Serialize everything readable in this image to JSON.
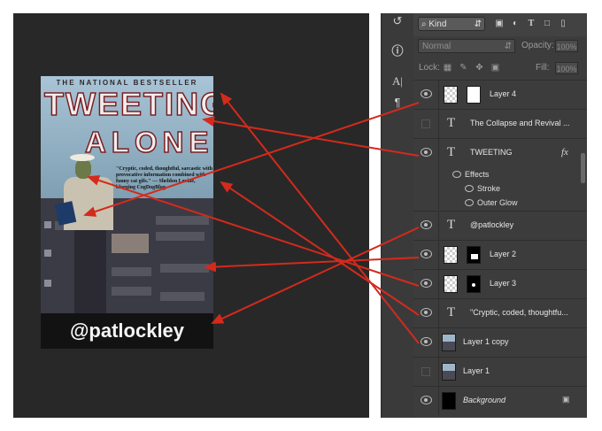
{
  "poster": {
    "subtitle": "THE NATIONAL BESTSELLER",
    "title_line1": "TWEETING",
    "title_line2": "ALONE",
    "quote": "\"Cryptic, coded, thoughtful, sarcastic with provocative information combined with funny cat gifs.\" — Sheldon Levine, blogging CogDogBlog",
    "handle": "@patlockley"
  },
  "panel": {
    "filter_kind": "Kind",
    "blend_mode": "Normal",
    "opacity_label": "Opacity:",
    "opacity_value": "100%",
    "lock_label": "Lock:",
    "fill_label": "Fill:",
    "fill_value": "100%",
    "layers": [
      {
        "name": "Layer 4",
        "type": "image",
        "visible": true
      },
      {
        "name": "The  Collapse and Revival ...",
        "type": "text",
        "visible": false
      },
      {
        "name": "TWEETING",
        "type": "text",
        "visible": true,
        "fx": "fx"
      },
      {
        "name": "@patlockley",
        "type": "text",
        "visible": true
      },
      {
        "name": "Layer 2",
        "type": "image",
        "visible": true
      },
      {
        "name": "Layer 3",
        "type": "image",
        "visible": true
      },
      {
        "name": "\"Cryptic, coded, thoughtfu...",
        "type": "text",
        "visible": true
      },
      {
        "name": "Layer 1 copy",
        "type": "image",
        "visible": true
      },
      {
        "name": "Layer 1",
        "type": "image",
        "visible": false
      },
      {
        "name": "Background",
        "type": "image",
        "visible": true,
        "locked": true
      }
    ],
    "effects": {
      "title": "Effects",
      "items": [
        "Stroke",
        "Outer Glow"
      ]
    }
  },
  "tools": [
    "history-icon",
    "info-icon",
    "character-icon",
    "paragraph-icon"
  ],
  "colors": {
    "arrow": "#d42a1c",
    "panel_bg": "#3c3c3c",
    "canvas_bg": "#282828"
  }
}
